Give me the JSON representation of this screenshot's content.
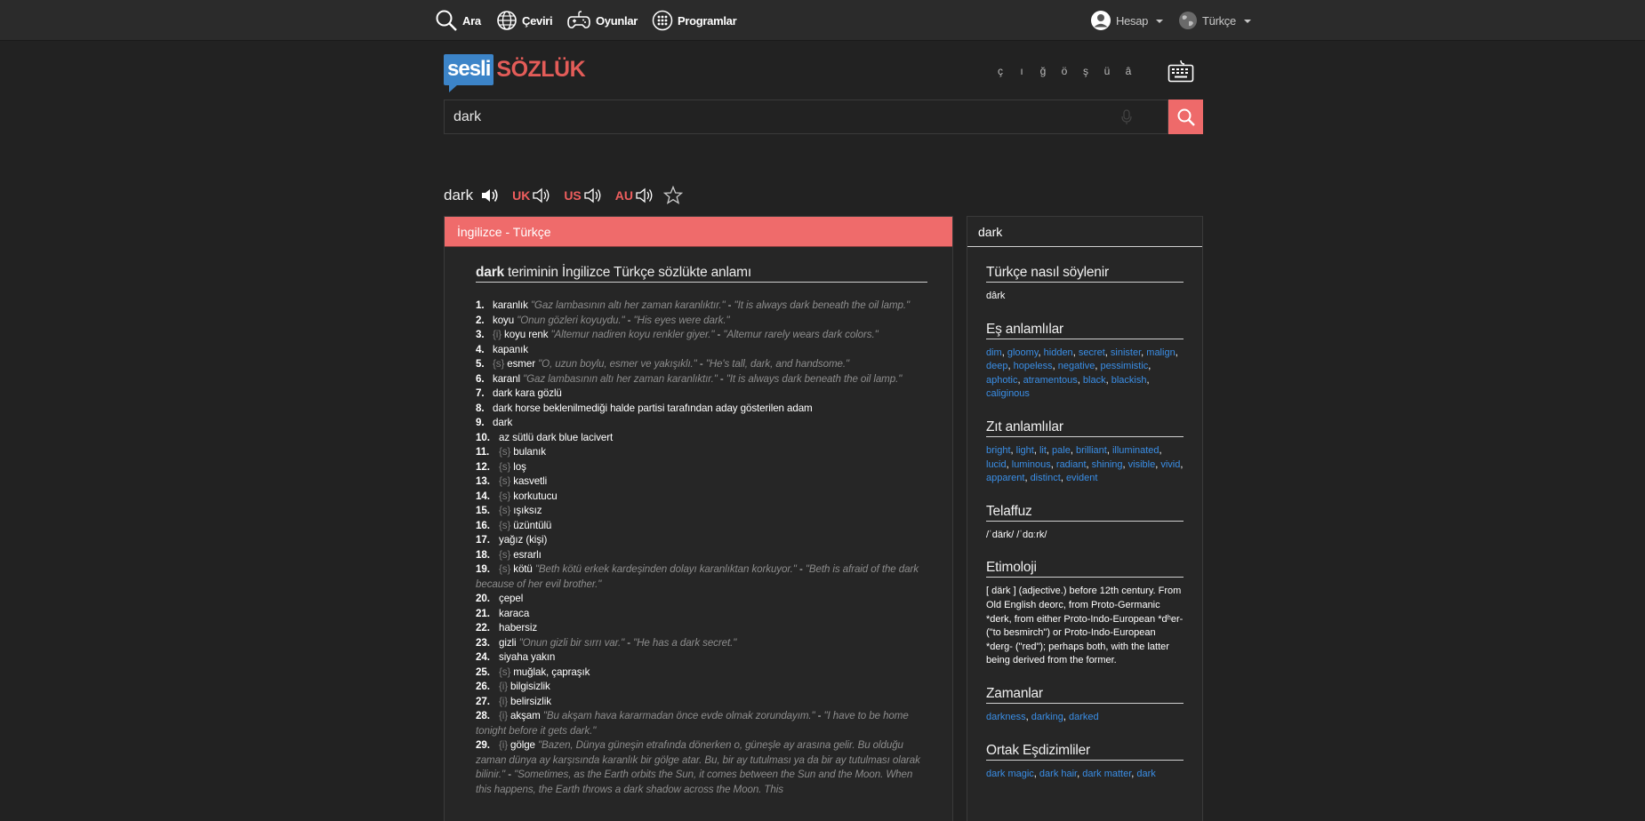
{
  "nav": {
    "search": "Ara",
    "translate": "Çeviri",
    "games": "Oyunlar",
    "programs": "Programlar",
    "account": "Hesap",
    "language": "Türkçe"
  },
  "logo": {
    "part1": "sesli",
    "part2": "SÖZLÜK"
  },
  "special_chars": [
    "ç",
    "ı",
    "ğ",
    "ö",
    "ş",
    "ü",
    "â"
  ],
  "search": {
    "value": "dark"
  },
  "word": {
    "title": "dark",
    "accents": [
      "UK",
      "US",
      "AU"
    ]
  },
  "panel": {
    "header": "İngilizce - Türkçe",
    "title_word": "dark",
    "title_rest": " teriminin İngilizce Türkçe sözlükte anlamı",
    "meanings": [
      {
        "n": "1.",
        "tag": "",
        "w": "karanlık",
        "ex": " \"Gaz lambasının altı her zaman karanlıktır.\"",
        "tr": " \"It is always dark beneath the oil lamp.\""
      },
      {
        "n": "2.",
        "tag": "",
        "w": "koyu",
        "ex": " \"Onun gözleri koyuydu.\"",
        "tr": " \"His eyes were dark.\""
      },
      {
        "n": "3.",
        "tag": "{i}",
        "w": "koyu renk",
        "ex": " \"Altemur nadiren koyu renkler giyer.\"",
        "tr": " \"Altemur rarely wears dark colors.\""
      },
      {
        "n": "4.",
        "tag": "",
        "w": "kapanık",
        "ex": "",
        "tr": ""
      },
      {
        "n": "5.",
        "tag": "{s}",
        "w": "esmer",
        "ex": " \"O, uzun boylu, esmer ve yakışıklı.\"",
        "tr": " \"He's tall, dark, and handsome.\""
      },
      {
        "n": "6.",
        "tag": "",
        "w": "karanl",
        "ex": " \"Gaz lambasının altı her zaman karanlıktır.\"",
        "tr": " \"It is always dark beneath the oil lamp.\""
      },
      {
        "n": "7.",
        "tag": "",
        "w": "dark kara gözlü",
        "ex": "",
        "tr": ""
      },
      {
        "n": "8.",
        "tag": "",
        "w": "dark horse beklenilmediği halde partisi tarafından aday gösterilen adam",
        "ex": "",
        "tr": ""
      },
      {
        "n": "9.",
        "tag": "",
        "w": "dark",
        "ex": "",
        "tr": ""
      },
      {
        "n": "10.",
        "tag": "",
        "w": "az sütlü dark blue lacivert",
        "ex": "",
        "tr": ""
      },
      {
        "n": "11.",
        "tag": "{s}",
        "w": "bulanık",
        "ex": "",
        "tr": ""
      },
      {
        "n": "12.",
        "tag": "{s}",
        "w": "loş",
        "ex": "",
        "tr": ""
      },
      {
        "n": "13.",
        "tag": "{s}",
        "w": "kasvetli",
        "ex": "",
        "tr": ""
      },
      {
        "n": "14.",
        "tag": "{s}",
        "w": "korkutucu",
        "ex": "",
        "tr": ""
      },
      {
        "n": "15.",
        "tag": "{s}",
        "w": "ışıksız",
        "ex": "",
        "tr": ""
      },
      {
        "n": "16.",
        "tag": "{s}",
        "w": "üzüntülü",
        "ex": "",
        "tr": ""
      },
      {
        "n": "17.",
        "tag": "",
        "w": "yağız (kişi)",
        "ex": "",
        "tr": ""
      },
      {
        "n": "18.",
        "tag": "{s}",
        "w": "esrarlı",
        "ex": "",
        "tr": ""
      },
      {
        "n": "19.",
        "tag": "{s}",
        "w": "kötü",
        "ex": " \"Beth kötü erkek kardeşinden dolayı karanlıktan korkuyor.\"",
        "tr": " \"Beth is afraid of the dark because of her evil brother.\""
      },
      {
        "n": "20.",
        "tag": "",
        "w": "çepel",
        "ex": "",
        "tr": ""
      },
      {
        "n": "21.",
        "tag": "",
        "w": "karaca",
        "ex": "",
        "tr": ""
      },
      {
        "n": "22.",
        "tag": "",
        "w": "habersiz",
        "ex": "",
        "tr": ""
      },
      {
        "n": "23.",
        "tag": "",
        "w": "gizli",
        "ex": " \"Onun gizli bir sırrı var.\"",
        "tr": " \"He has a dark secret.\""
      },
      {
        "n": "24.",
        "tag": "",
        "w": "siyaha yakın",
        "ex": "",
        "tr": ""
      },
      {
        "n": "25.",
        "tag": "{s}",
        "w": "muğlak, çapraşık",
        "ex": "",
        "tr": ""
      },
      {
        "n": "26.",
        "tag": "{i}",
        "w": "bilgisizlik",
        "ex": "",
        "tr": ""
      },
      {
        "n": "27.",
        "tag": "{i}",
        "w": "belirsizlik",
        "ex": "",
        "tr": ""
      },
      {
        "n": "28.",
        "tag": "{i}",
        "w": "akşam",
        "ex": " \"Bu akşam hava kararmadan önce evde olmak zorundayım.\"",
        "tr": " \"I have to be home tonight before it gets dark.\""
      },
      {
        "n": "29.",
        "tag": "{i}",
        "w": "gölge",
        "ex": " \"Bazen, Dünya güneşin etrafında dönerken o, güneşle ay arasına gelir. Bu olduğu zaman dünya ay karşısında karanlık bir gölge atar. Bu, bir ay tutulması ya da bir ay tutulması olarak bilinir.\"",
        "tr": " \"Sometimes, as the Earth orbits the Sun, it comes between the Sun and the Moon. When this happens, the Earth throws a dark shadow across the Moon. This"
      }
    ]
  },
  "sidebar": {
    "head": "dark",
    "pron_title": "Türkçe nasıl söylenir",
    "pron_text": "dârk",
    "syn_title": "Eş anlamlılar",
    "synonyms": [
      "dim",
      "gloomy",
      "hidden",
      "secret",
      "sinister",
      "malign",
      "deep",
      "hopeless",
      "negative",
      "pessimistic",
      "aphotic",
      "atramentous",
      "black",
      "blackish",
      "caliginous"
    ],
    "ant_title": "Zıt anlamlılar",
    "antonyms": [
      "bright",
      "light",
      "lit",
      "pale",
      "brilliant",
      "illuminated",
      "lucid",
      "luminous",
      "radiant",
      "shining",
      "visible",
      "vivid",
      "apparent",
      "distinct",
      "evident"
    ],
    "tel_title": "Telaffuz",
    "tel_text": "/ˈdärk/ /ˈdɑːrk/",
    "etym_title": "Etimoloji",
    "etym_text": "[ därk ] (adjective.) before 12th century. From Old English deorc, from Proto-Germanic *derk, from either Proto-Indo-European *dʰer- (\"to besmirch\") or Proto-Indo-European *derg- (\"red\"); perhaps both, with the latter being derived from the former.",
    "tenses_title": "Zamanlar",
    "tenses": [
      "darkness",
      "darking",
      "darked"
    ],
    "coll_title": "Ortak Eşdizimliler",
    "collocations": [
      "dark magic",
      "dark hair",
      "dark matter",
      "dark"
    ]
  }
}
